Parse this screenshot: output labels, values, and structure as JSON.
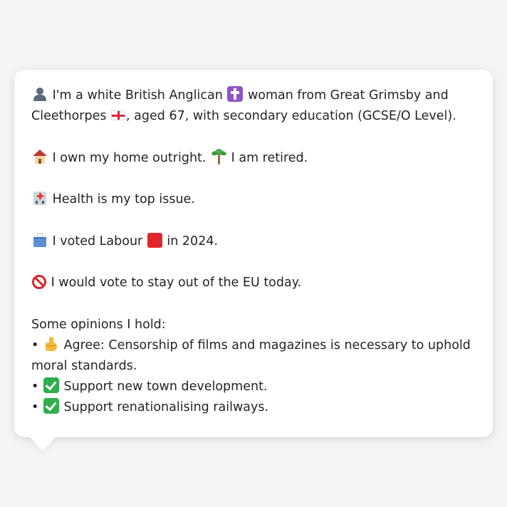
{
  "message": {
    "line1": {
      "emoji_person": "bust-in-silhouette-icon",
      "text_a": "I'm a white British Anglican",
      "emoji_cross": "latin-cross-icon",
      "text_b": "woman from Great Grimsby and Cleethorpes",
      "emoji_flag": "england-flag-icon",
      "text_c": ", aged 67, with secondary education (GCSE/O Level)."
    },
    "line2": {
      "emoji_house": "house-icon",
      "text_a": "I own my home outright.",
      "emoji_palm": "palm-tree-icon",
      "text_b": "I am retired."
    },
    "line3": {
      "emoji_hospital": "hospital-icon",
      "text": "Health is my top issue."
    },
    "line4": {
      "emoji_ballot": "ballot-box-icon",
      "text_a": "I voted Labour",
      "emoji_party": "red-square-icon",
      "text_b": "in 2024."
    },
    "line5": {
      "emoji_no": "prohibited-icon",
      "text": "I would vote to stay out of the EU today."
    },
    "opinions_heading": "Some opinions I hold:",
    "opinions": [
      {
        "bullet": "•",
        "icon": "thumbs-up-icon",
        "text": "Agree: Censorship of films and magazines is necessary to uphold moral standards."
      },
      {
        "bullet": "•",
        "icon": "check-mark-icon",
        "text": "Support new town development."
      },
      {
        "bullet": "•",
        "icon": "check-mark-icon",
        "text": "Support renationalising railways."
      }
    ]
  },
  "colors": {
    "background": "#f3f4f6",
    "bubble": "#ffffff",
    "text": "#1f2328",
    "check_green": "#2eae4b",
    "labour_red": "#e0262b"
  }
}
